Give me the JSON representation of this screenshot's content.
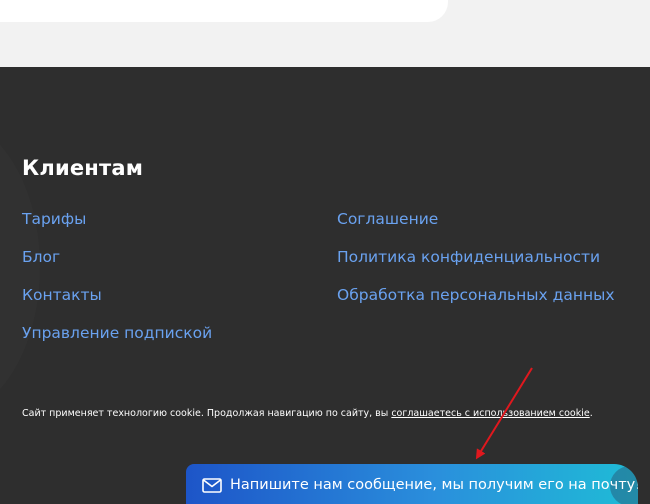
{
  "footer": {
    "title": "Клиентам",
    "links_left": [
      {
        "label": "Тарифы"
      },
      {
        "label": "Блог"
      },
      {
        "label": "Контакты"
      },
      {
        "label": "Управление подпиской"
      }
    ],
    "links_right": [
      {
        "label": "Соглашение"
      },
      {
        "label": "Политика конфиденциальности"
      },
      {
        "label": "Обработка персональных данных"
      }
    ],
    "cookie_notice": {
      "text": "Сайт применяет технологию cookie. Продолжая навигацию по сайту, вы ",
      "link": "соглашаетесь с использованием cookie",
      "suffix": "."
    }
  },
  "chat_widget": {
    "label": "Напишите нам сообщение, мы получим его на почту!",
    "icon": "mail-icon"
  },
  "colors": {
    "footer_bg": "#2e2e2e",
    "link": "#6aa2f0",
    "arrow": "#e0181e"
  }
}
